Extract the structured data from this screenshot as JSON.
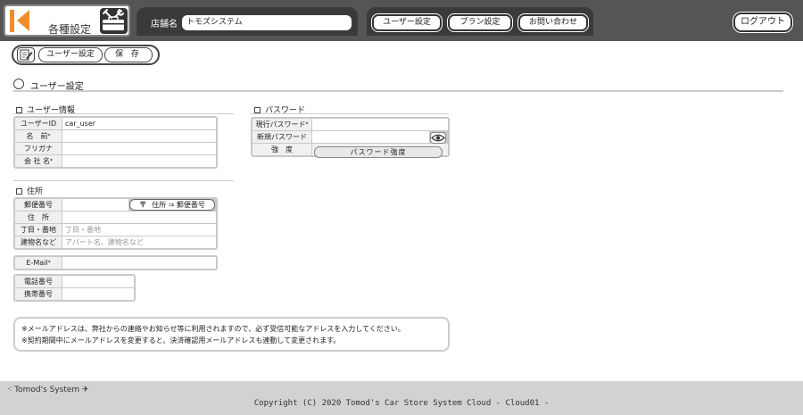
{
  "header": {
    "title": "各種設定",
    "store_label": "店舗名",
    "store_name": "トモズシステム",
    "nav": [
      {
        "label": "ユーザー設定"
      },
      {
        "label": "プラン設定"
      },
      {
        "label": "お問い合わせ"
      }
    ],
    "logout_label": "ログアウト",
    "accent_color": "#f28c28"
  },
  "toolbar": {
    "icon": "edit-document-icon",
    "user_settings_label": "ユーザー設定",
    "save_label": "保 存"
  },
  "section": {
    "title": "ユーザー設定"
  },
  "user_info": {
    "heading": "ユーザー情報",
    "fields": [
      {
        "label": "ユーザーID",
        "value": "car_user"
      },
      {
        "label": "名　前",
        "value": ""
      },
      {
        "label": "フリガナ",
        "value": ""
      },
      {
        "label": "会 社 名",
        "value": ""
      }
    ]
  },
  "address": {
    "heading": "住所",
    "postal_label": "郵便番号",
    "postal_value": "",
    "postal_button": "住所 ⇒ 郵便番号",
    "address_label": "住　所",
    "address_value": "",
    "block_label": "丁目・番地",
    "block_placeholder": "丁目・番地",
    "building_label": "建物名など",
    "building_placeholder": "アパート名、建物名など"
  },
  "email": {
    "label": "E-Mail",
    "value": ""
  },
  "phones": {
    "phone_label": "電話番号",
    "phone_value": "",
    "mobile_label": "携帯番号",
    "mobile_value": ""
  },
  "password": {
    "heading": "パスワード",
    "current_label": "現行パスワード",
    "current_value": "",
    "new_label": "新規パスワード",
    "new_value": "",
    "strength_label": "強　度",
    "strength_button": "パスワード強度"
  },
  "notes": [
    "※メールアドレスは、弊社からの連絡やお知らせ等に利用されますので、必ず受信可能なアドレスを入力してください。",
    "※契約期間中にメールアドレスを変更すると、決済確認用メールアドレスも連動して変更されます。"
  ],
  "footer": {
    "brand": "Tomod's System",
    "copyright": "Copyright (C) 2020 Tomod's Car Store System Cloud - Cloud01 -"
  }
}
